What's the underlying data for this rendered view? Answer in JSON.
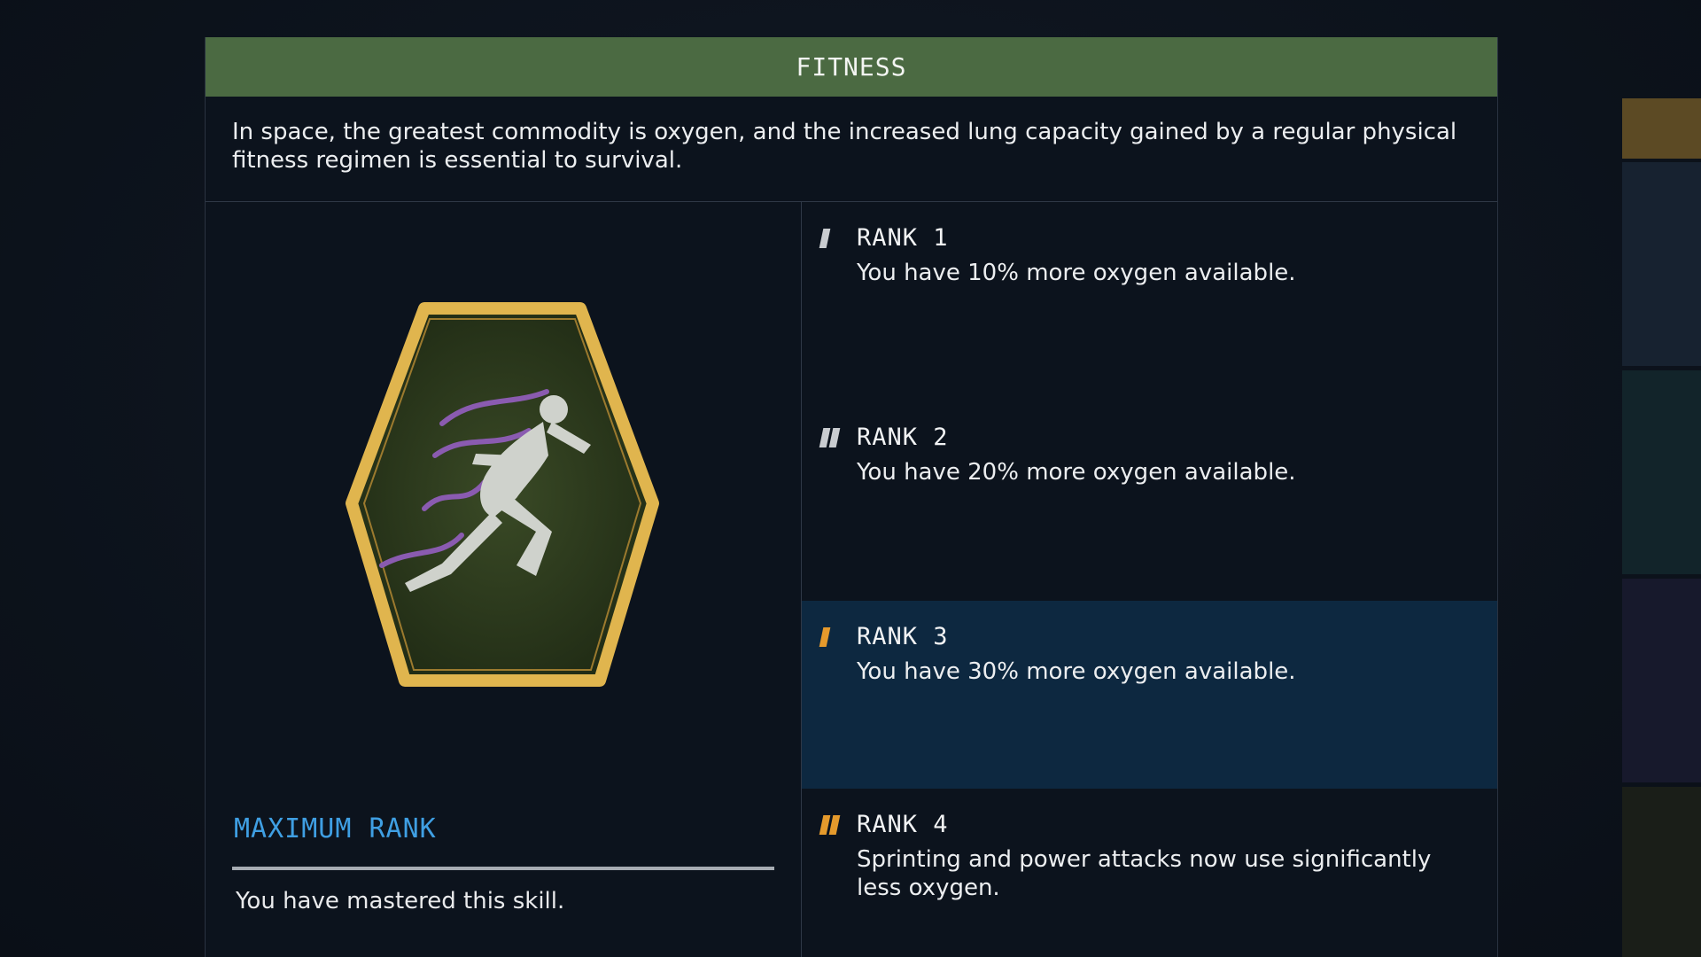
{
  "skill": {
    "title": "FITNESS",
    "description": "In space, the greatest commodity is oxygen, and the increased lung capacity gained by a regular physical fitness regimen is essential to survival.",
    "badge_icon": "sprinting-figure-icon",
    "status_label": "MAXIMUM RANK",
    "status_text": "You have mastered this skill."
  },
  "ranks": [
    {
      "label": "RANK 1",
      "description": "You have 10% more oxygen available.",
      "pip_count": 1,
      "pip_color": "#c9ccd0",
      "active": false
    },
    {
      "label": "RANK 2",
      "description": "You have 20% more oxygen available.",
      "pip_count": 2,
      "pip_color": "#c9ccd0",
      "active": false
    },
    {
      "label": "RANK 3",
      "description": "You have 30% more oxygen available.",
      "pip_count": 1,
      "pip_color": "#e59a2c",
      "active": true
    },
    {
      "label": "RANK 4",
      "description": "Sprinting and power attacks now use significantly less oxygen.",
      "pip_count": 2,
      "pip_color": "#e59a2c",
      "active": false
    }
  ],
  "colors": {
    "title_bar": "#4b6a42",
    "max_rank_text": "#3f9fe3",
    "active_rank_bg": "#0d2840",
    "badge_border": "#e0b54e",
    "badge_fill": "#2f3e1f"
  }
}
